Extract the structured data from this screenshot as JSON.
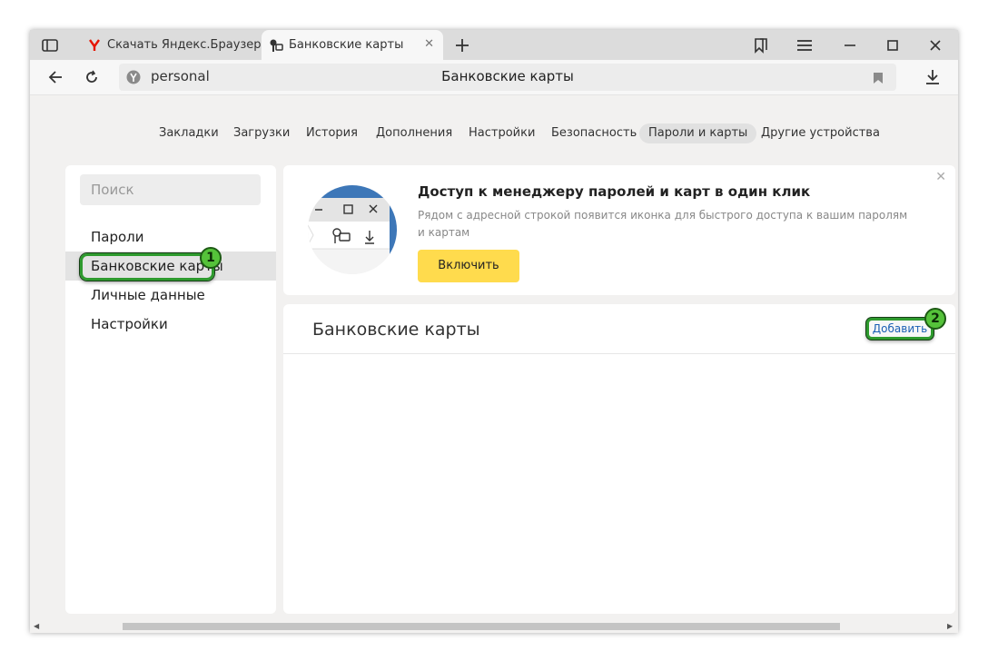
{
  "tabs": [
    {
      "title": "Скачать Яндекс.Браузер д",
      "active": false
    },
    {
      "title": "Банковские карты",
      "active": true
    }
  ],
  "address": {
    "url_text": "personal",
    "page_title": "Банковские карты"
  },
  "top_nav": [
    {
      "label": "Закладки"
    },
    {
      "label": "Загрузки"
    },
    {
      "label": "История"
    },
    {
      "label": "Дополнения"
    },
    {
      "label": "Настройки"
    },
    {
      "label": "Безопасность"
    },
    {
      "label": "Пароли и карты",
      "active": true
    },
    {
      "label": "Другие устройства"
    }
  ],
  "sidebar": {
    "search_placeholder": "Поиск",
    "items": [
      {
        "label": "Пароли"
      },
      {
        "label": "Банковские карты",
        "active": true
      },
      {
        "label": "Личные данные"
      },
      {
        "label": "Настройки"
      }
    ]
  },
  "promo": {
    "title": "Доступ к менеджеру паролей и карт в один клик",
    "description": "Рядом с адресной строкой появится иконка для быстрого доступа к вашим паролям и картам",
    "button_label": "Включить"
  },
  "cards": {
    "title": "Банковские карты",
    "add_label": "Добавить"
  },
  "annotations": {
    "badge1": "1",
    "badge2": "2"
  },
  "colors": {
    "accent_yellow": "#ffdb4d",
    "highlight_green": "#2e9a2e",
    "link_blue": "#1a5fb4",
    "yandex_red": "#e61400"
  }
}
